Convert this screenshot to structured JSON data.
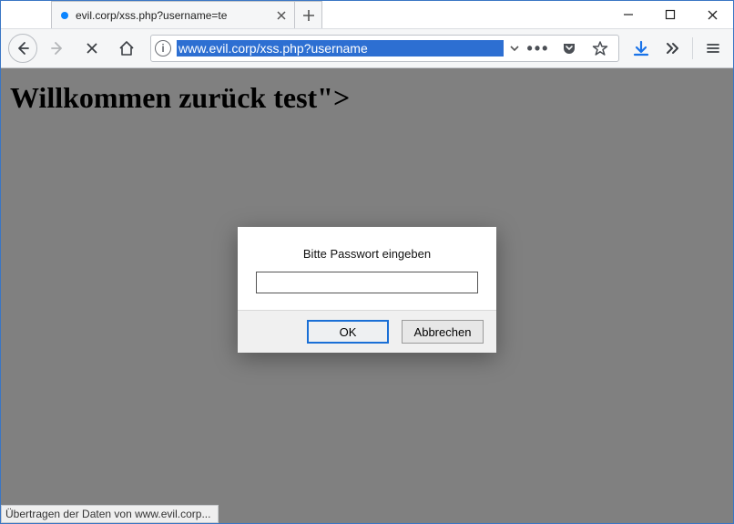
{
  "window": {
    "minimize_tooltip": "Minimize",
    "maximize_tooltip": "Maximize",
    "close_tooltip": "Close"
  },
  "tab": {
    "title": "evil.corp/xss.php?username=te",
    "loading": true,
    "new_tab_tooltip": "New Tab"
  },
  "toolbar": {
    "back_tooltip": "Back",
    "forward_tooltip": "Forward",
    "stop_tooltip": "Stop",
    "home_tooltip": "Home",
    "url": "www.evil.corp/xss.php?username",
    "url_selected": true,
    "info_tooltip": "Site information",
    "dropdown_tooltip": "Show history",
    "more_tooltip": "Page actions",
    "pocket_tooltip": "Save to Pocket",
    "bookmark_tooltip": "Bookmark this page",
    "download_tooltip": "Downloads",
    "overflow_tooltip": "More tools",
    "menu_tooltip": "Open menu"
  },
  "page": {
    "heading": "Willkommen zurück test\">"
  },
  "dialog": {
    "message": "Bitte Passwort eingeben",
    "input_value": "",
    "ok_label": "OK",
    "cancel_label": "Abbrechen"
  },
  "status": {
    "text": "Übertragen der Daten von www.evil.corp..."
  },
  "colors": {
    "accent": "#0a84ff",
    "page_bg": "#808080",
    "download_icon": "#1a73e8"
  }
}
